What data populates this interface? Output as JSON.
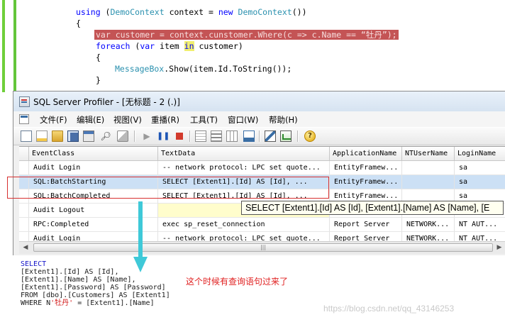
{
  "code": {
    "line1": {
      "kw": "using",
      "rest1": " (",
      "type1": "DemoContext",
      "rest2": " context = ",
      "kw2": "new",
      "sp": " ",
      "type2": "DemoContext",
      "rest3": "())"
    },
    "line2": "{",
    "line3": {
      "kw": "var",
      "rest1": " customer = context.cunstomer.Where(c => c.Name == ",
      "str": "“牡丹”",
      "rest2": ");"
    },
    "line4": {
      "kw": "foreach",
      "rest1": " (",
      "kw2": "var",
      "rest2": " item ",
      "kw3": "in",
      "rest3": " customer)"
    },
    "line5": "{",
    "line6": {
      "type": "MessageBox",
      "rest": ".Show(item.Id.ToString());"
    },
    "line7": "}",
    "line8": "}"
  },
  "profiler": {
    "title": "SQL Server Profiler - [无标题 - 2 (.)]",
    "menu": [
      "文件(F)",
      "编辑(E)",
      "视图(V)",
      "重播(R)",
      "工具(T)",
      "窗口(W)",
      "帮助(H)"
    ],
    "toolbar_icons": [
      "new-trace-icon",
      "new-template-icon",
      "open-icon",
      "save-icon",
      "properties-icon",
      "find-icon",
      "clear-icon",
      "run-icon",
      "pause-icon",
      "stop-icon",
      "group-icon",
      "aggregate-icon",
      "columns-icon",
      "import-icon",
      "activity-monitor-icon",
      "performance-icon",
      "help-icon"
    ],
    "columns": [
      "EventClass",
      "TextData",
      "ApplicationName",
      "NTUserName",
      "LoginName"
    ],
    "rows": [
      [
        "Audit Login",
        "-- network protocol: LPC  set quote...",
        "EntityFramew...",
        "",
        "sa"
      ],
      [
        "SQL:BatchStarting",
        "SELECT   [Extent1].[Id] AS [Id],   ...",
        "EntityFramew...",
        "",
        "sa"
      ],
      [
        "SQL:BatchCompleted",
        "SELECT   [Extent1].[Id] AS [Id],   ...",
        "EntityFramew...",
        "",
        "sa"
      ],
      [
        "Audit Logout",
        "",
        "",
        "",
        ""
      ],
      [
        "RPC:Completed",
        "exec sp_reset_connection",
        "Report Server",
        "NETWORK...",
        "NT AUT..."
      ],
      [
        "Audit Login",
        "-- network protocol: LPC  set quote...",
        "Report Server",
        "NETWORK...",
        "NT AUT..."
      ]
    ],
    "tooltip": "SELECT    [Extent1].[Id] AS [Id],    [Extent1].[Name] AS [Name],    [E"
  },
  "sql": {
    "l1": "SELECT",
    "l2": "[Extent1].[Id] AS [Id],",
    "l3": "[Extent1].[Name] AS [Name],",
    "l4": "[Extent1].[Password] AS [Password]",
    "l5": "FROM [dbo].[Customers] AS [Extent1]",
    "l6a": "WHERE N",
    "l6b": "'牡丹'",
    "l6c": " = [Extent1].[Name]"
  },
  "annotation": "这个时候有查询语句过来了",
  "watermark": "https://blog.csdn.net/qq_43146253",
  "colors": {
    "highlight_line": "#c45455",
    "selected_row": "#cce0f5",
    "annotation": "#e02020",
    "arrow": "#3fc9d8"
  }
}
